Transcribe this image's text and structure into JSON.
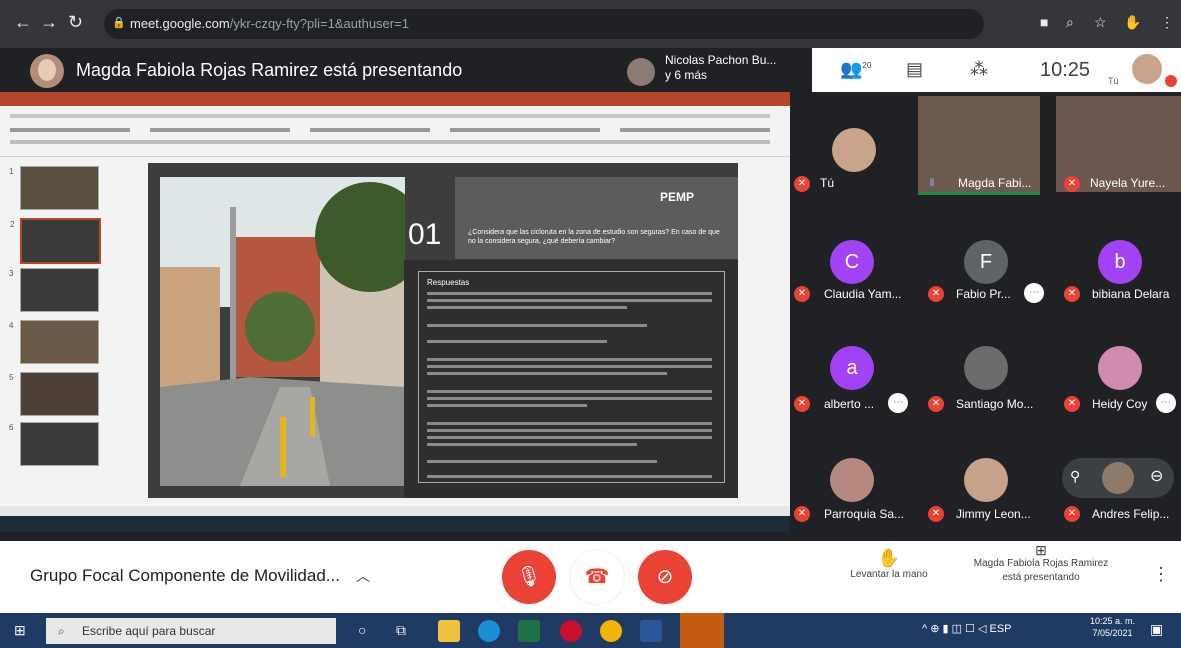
{
  "browser": {
    "url_host": "meet.google.com",
    "url_path": "/ykr-czqy-fty?pli=1&authuser=1"
  },
  "meet": {
    "presenting_banner": "Magda Fabiola Rojas Ramirez está presentando",
    "others_line1": "Nicolas Pachon Bu...",
    "others_line2": "y 6 más",
    "participants_count": "20",
    "self_initials": "Tú",
    "clock": "10:25"
  },
  "slide": {
    "number": "01",
    "logo_text": "PEMP",
    "question": "¿Considera que las cicloruta en la zona de estudio son seguras? En caso de que no la considera segura, ¿qué debería cambiar?",
    "answer_heading": "Respuestas"
  },
  "thumbnails": [
    {
      "n": "1"
    },
    {
      "n": "2"
    },
    {
      "n": "3"
    },
    {
      "n": "4"
    },
    {
      "n": "5"
    },
    {
      "n": "6"
    }
  ],
  "participants": [
    {
      "name": "Tú",
      "initial": "",
      "color": "#c9a48b"
    },
    {
      "name": "Magda Fabi...",
      "initial": "",
      "color": "#7a6255"
    },
    {
      "name": "Nayela Yure...",
      "initial": "",
      "color": "#5b4a46"
    },
    {
      "name": "Claudia Yam...",
      "initial": "C",
      "color": "#a142f4"
    },
    {
      "name": "Fabio Pr...",
      "initial": "F",
      "color": "#5f6368"
    },
    {
      "name": "bibiana Delara",
      "initial": "b",
      "color": "#a142f4"
    },
    {
      "name": "alberto ...",
      "initial": "a",
      "color": "#a142f4"
    },
    {
      "name": "Santiago Mo...",
      "initial": "",
      "color": "#6b6b6b"
    },
    {
      "name": "Heidy Coy",
      "initial": "",
      "color": "#d08bb0"
    },
    {
      "name": "Parroquia Sa...",
      "initial": "",
      "color": "#b58a7e"
    },
    {
      "name": "Jimmy Leon...",
      "initial": "",
      "color": "#c7a28a"
    },
    {
      "name": "Andres Felip...",
      "initial": "",
      "color": "#8f7a6a"
    }
  ],
  "bottom": {
    "meeting_title": "Grupo Focal Componente de Movilidad...",
    "raise_hand": "Levantar la mano",
    "presenting_line1": "Magda Fabiola Rojas Ramirez",
    "presenting_line2": "está presentando"
  },
  "taskbar": {
    "search_placeholder": "Escribe aquí para buscar",
    "lang": "ESP",
    "time": "10:25 a. m.",
    "date": "7/05/2021"
  },
  "colors": {
    "accent_red": "#ea4335",
    "ppt_red": "#b7472a",
    "meet_dark": "#202124"
  }
}
